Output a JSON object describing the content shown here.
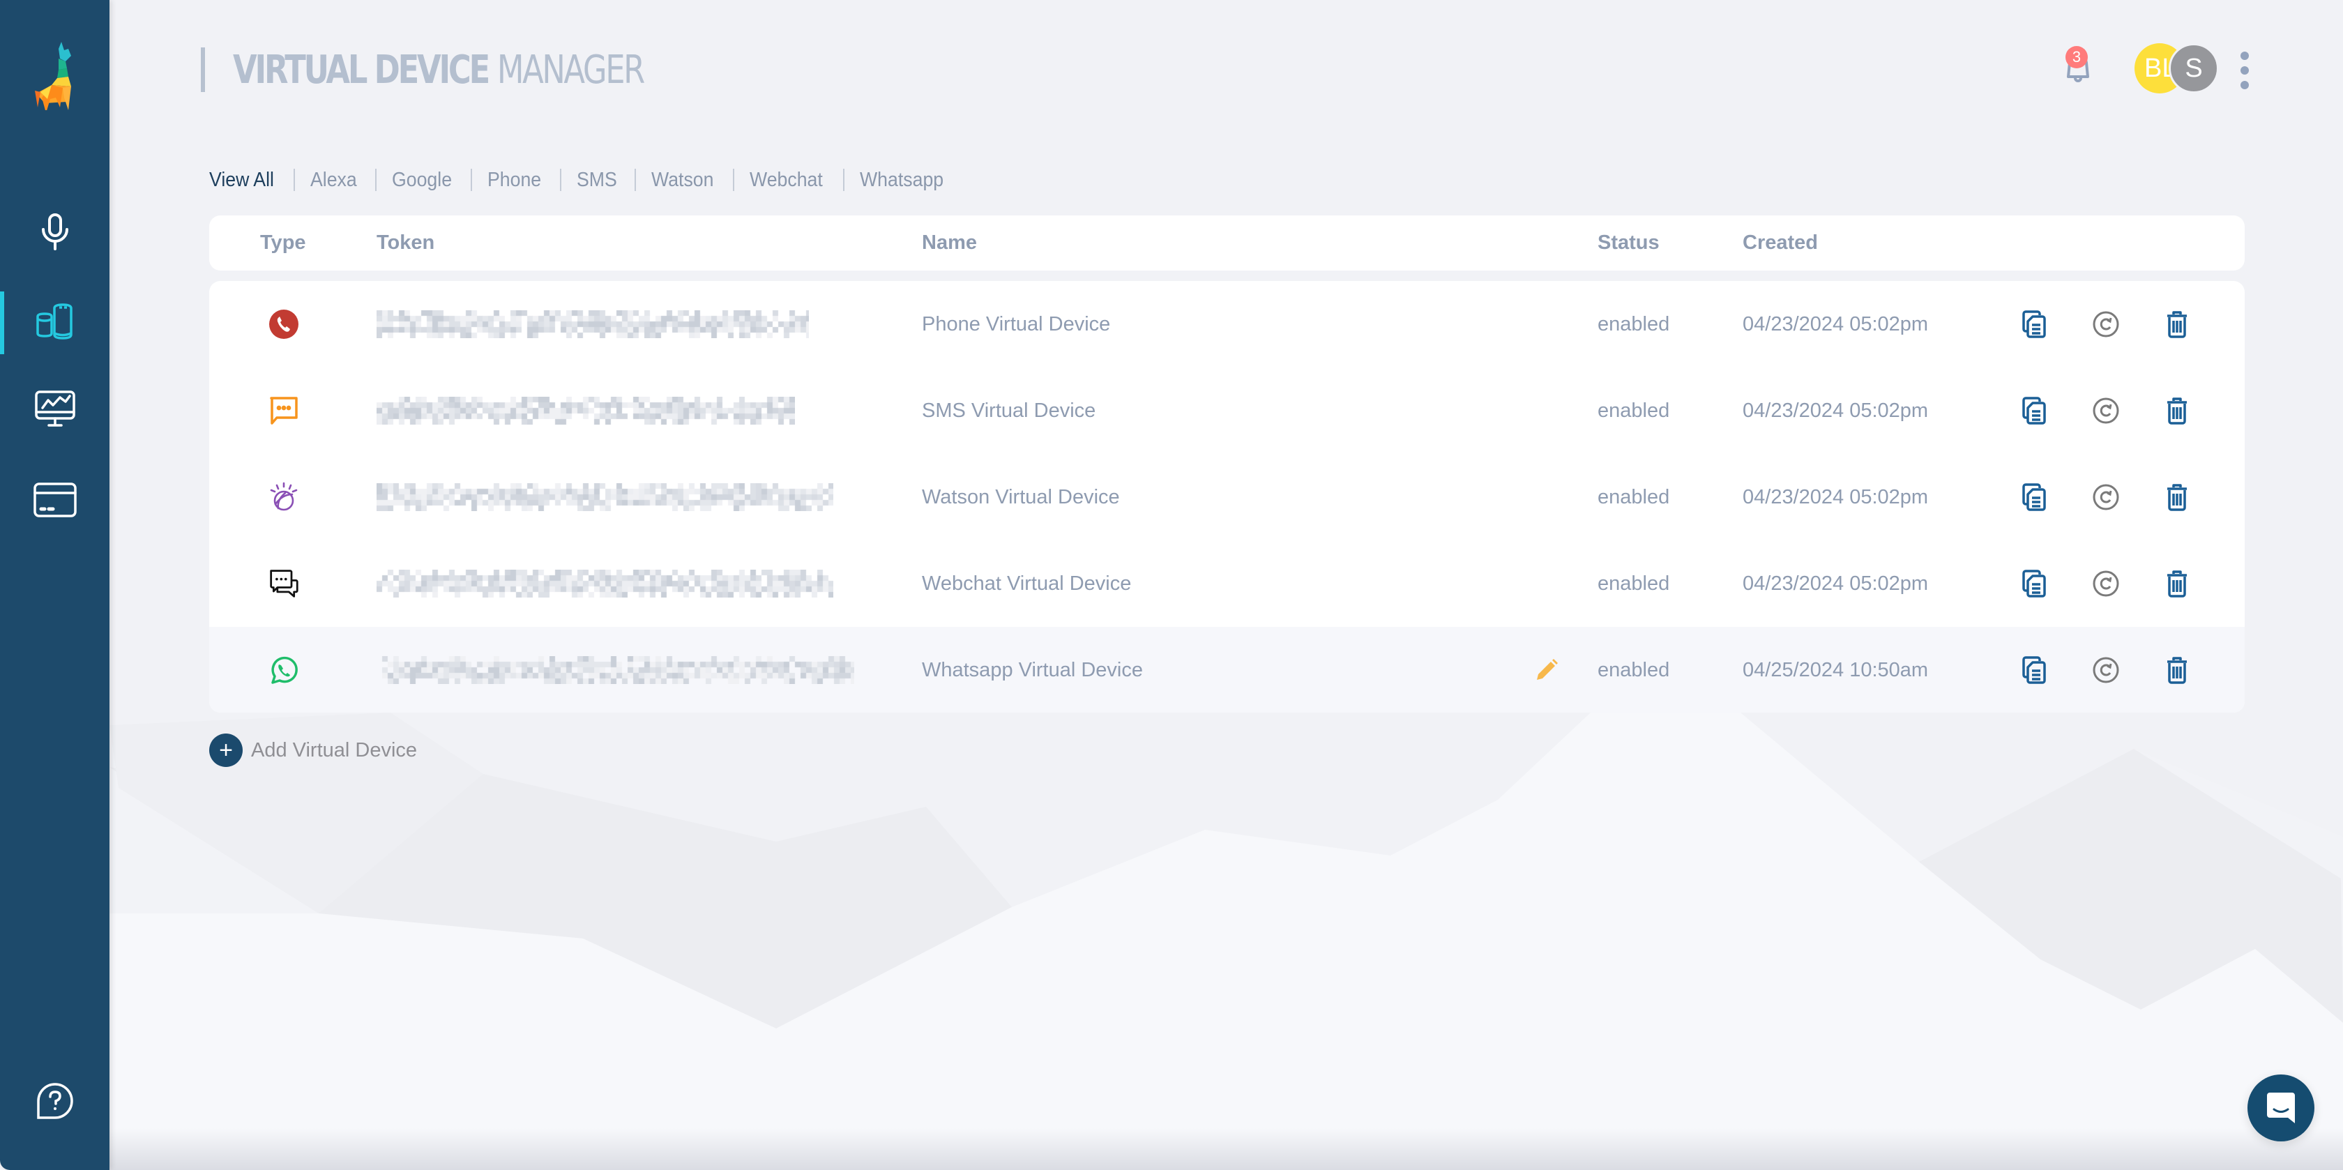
{
  "app": {
    "title_bold": "VIRTUAL DEVICE",
    "title_light": "MANAGER"
  },
  "sidebar": {
    "logo": "llama-logo",
    "items": [
      {
        "name": "voice-apps",
        "icon": "microphone-icon",
        "active": false
      },
      {
        "name": "virtual-devices",
        "icon": "smart-speakers-icon",
        "active": true
      },
      {
        "name": "monitoring",
        "icon": "monitor-chart-icon",
        "active": false
      },
      {
        "name": "billing",
        "icon": "credit-card-icon",
        "active": false
      }
    ],
    "help_icon": "help-bubble-icon"
  },
  "topbar": {
    "notifications_count": "3",
    "avatars": [
      {
        "initials": "BL",
        "color": "#fddf3b"
      },
      {
        "initials": "S",
        "color": "#96979b"
      }
    ]
  },
  "filters": {
    "tabs": [
      "View All",
      "Alexa",
      "Google",
      "Phone",
      "SMS",
      "Watson",
      "Webchat",
      "Whatsapp"
    ],
    "active": "View All"
  },
  "table": {
    "columns": {
      "type": "Type",
      "token": "Token",
      "name": "Name",
      "status": "Status",
      "created": "Created"
    },
    "rows": [
      {
        "type": "phone",
        "type_icon": "phone-icon",
        "token_redacted": true,
        "name": "Phone Virtual Device",
        "status": "enabled",
        "created": "04/23/2024 05:02pm",
        "editable": false,
        "highlighted": false
      },
      {
        "type": "sms",
        "type_icon": "sms-icon",
        "token_redacted": true,
        "name": "SMS Virtual Device",
        "status": "enabled",
        "created": "04/23/2024 05:02pm",
        "editable": false,
        "highlighted": false
      },
      {
        "type": "watson",
        "type_icon": "watson-icon",
        "token_redacted": true,
        "name": "Watson Virtual Device",
        "status": "enabled",
        "created": "04/23/2024 05:02pm",
        "editable": false,
        "highlighted": false
      },
      {
        "type": "webchat",
        "type_icon": "webchat-icon",
        "token_redacted": true,
        "name": "Webchat Virtual Device",
        "status": "enabled",
        "created": "04/23/2024 05:02pm",
        "editable": false,
        "highlighted": false
      },
      {
        "type": "whatsapp",
        "type_icon": "whatsapp-icon",
        "token_redacted": true,
        "name": "Whatsapp Virtual Device",
        "status": "enabled",
        "created": "04/25/2024 10:50am",
        "editable": true,
        "highlighted": true
      }
    ],
    "row_actions": [
      {
        "name": "copy-token",
        "icon": "copy-document-icon"
      },
      {
        "name": "refresh-token",
        "icon": "refresh-circle-icon"
      },
      {
        "name": "delete-device",
        "icon": "trash-icon"
      }
    ]
  },
  "add_device": {
    "label": "Add Virtual Device"
  },
  "colors": {
    "sidebar": "#1d4a6b",
    "accent_active": "#25c9e0",
    "phone": "#c23b32",
    "sms": "#f7941d",
    "watson": "#8a4fb5",
    "webchat": "#111111",
    "whatsapp": "#1fbd6a",
    "action_blue": "#1b5f96",
    "action_gray": "#7a7a7a",
    "edit": "#f7b84b",
    "badge": "#ff7b7b"
  }
}
